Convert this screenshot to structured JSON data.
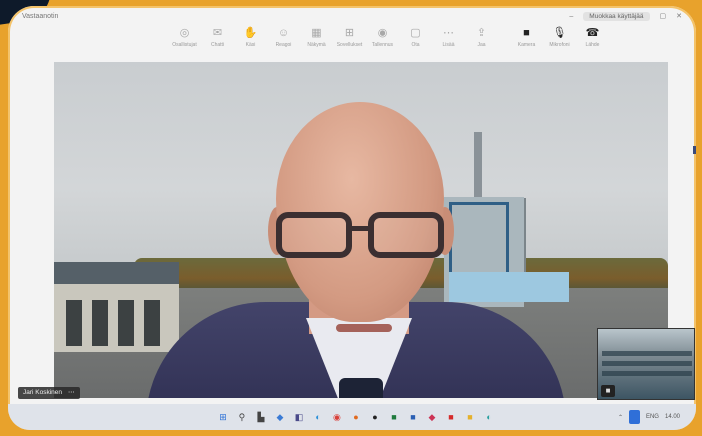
{
  "window": {
    "title": "Vastaanotin",
    "user_chip": "Muokkaa käyttäjää"
  },
  "toolbar": {
    "items": [
      {
        "label": "Osallistujat",
        "icon": "participants-icon",
        "glyph": "◎"
      },
      {
        "label": "Chatti",
        "icon": "chat-icon",
        "glyph": "✉"
      },
      {
        "label": "Käsi",
        "icon": "hand-icon",
        "glyph": "✋"
      },
      {
        "label": "Reagoi",
        "icon": "react-icon",
        "glyph": "☺"
      },
      {
        "label": "Näkymä",
        "icon": "view-icon",
        "glyph": "▦"
      },
      {
        "label": "Sovellukset",
        "icon": "apps-icon",
        "glyph": "⊞"
      },
      {
        "label": "Tallennus",
        "icon": "record-icon",
        "glyph": "◉"
      },
      {
        "label": "Ota",
        "icon": "capture-icon",
        "glyph": "▢"
      },
      {
        "label": "Lisää",
        "icon": "more-icon",
        "glyph": "⋯"
      },
      {
        "label": "Jaa",
        "icon": "share-icon",
        "glyph": "⇪"
      },
      {
        "label": "Kamera",
        "icon": "camera-icon",
        "glyph": "■"
      },
      {
        "label": "Mikrofoni",
        "icon": "mic-icon",
        "glyph": "🎙"
      },
      {
        "label": "Lähde",
        "icon": "leave-icon",
        "glyph": "☎"
      }
    ]
  },
  "video": {
    "participant_name": "Jari Koskinen",
    "name_menu": "⋯"
  },
  "selfview": {
    "camera_glyph": "■"
  },
  "taskbar": {
    "icons": [
      {
        "name": "start-icon",
        "glyph": "⊞",
        "color": "#2a6fd6"
      },
      {
        "name": "search-icon",
        "glyph": "⚲",
        "color": "#444"
      },
      {
        "name": "taskview-icon",
        "glyph": "▙",
        "color": "#444"
      },
      {
        "name": "widgets-icon",
        "glyph": "◆",
        "color": "#3a7bd5"
      },
      {
        "name": "teams-icon",
        "glyph": "◧",
        "color": "#4a4a8a"
      },
      {
        "name": "edge-icon",
        "glyph": "◐",
        "color": "#2b8fd8"
      },
      {
        "name": "chrome-icon",
        "glyph": "◉",
        "color": "#d9403a"
      },
      {
        "name": "firefox-icon",
        "glyph": "●",
        "color": "#e06a20"
      },
      {
        "name": "app-icon",
        "glyph": "●",
        "color": "#222"
      },
      {
        "name": "excel-icon",
        "glyph": "■",
        "color": "#1f7a3e"
      },
      {
        "name": "word-icon",
        "glyph": "■",
        "color": "#2a5fb3"
      },
      {
        "name": "notify-icon",
        "glyph": "◆",
        "color": "#cc3355"
      },
      {
        "name": "acrobat-icon",
        "glyph": "■",
        "color": "#d52b2b"
      },
      {
        "name": "files-icon",
        "glyph": "■",
        "color": "#e5b12c"
      },
      {
        "name": "store-icon",
        "glyph": "◐",
        "color": "#2aa0a0"
      }
    ],
    "tray_right": [
      "⌃",
      "ENG",
      "14.00"
    ]
  }
}
